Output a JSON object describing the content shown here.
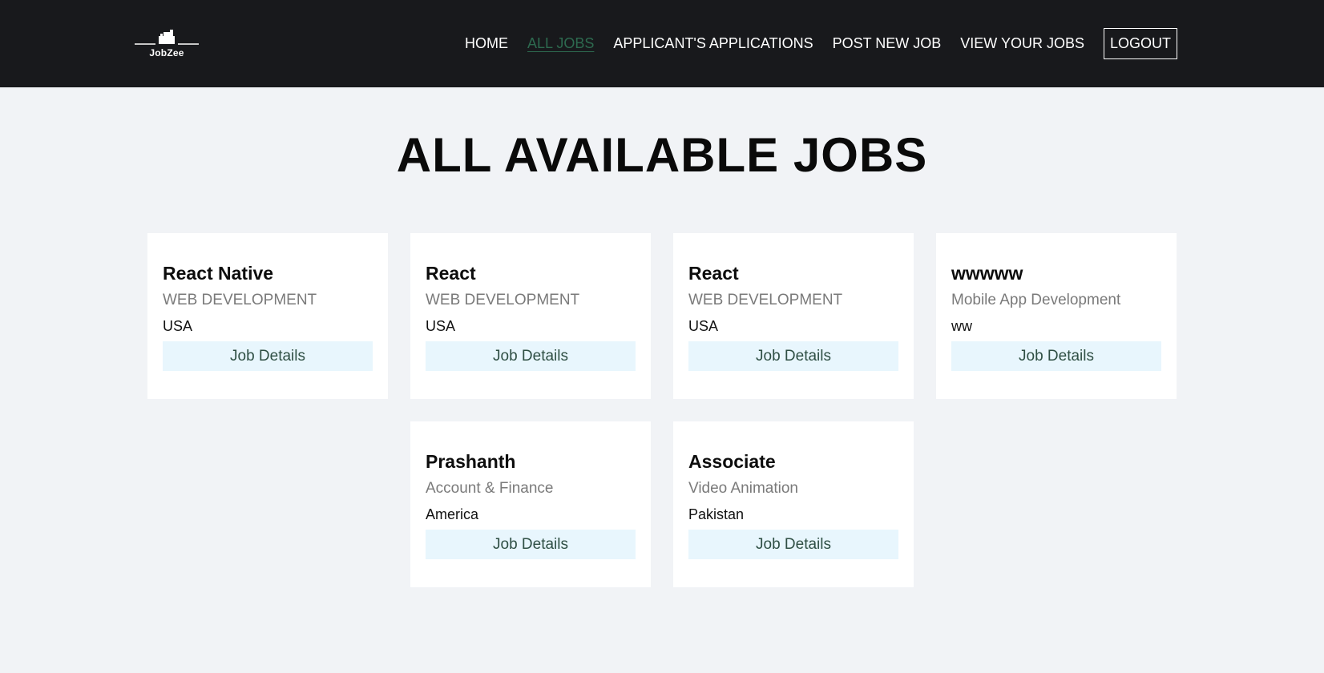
{
  "brand": {
    "name": "JobZee"
  },
  "nav": {
    "items": [
      {
        "label": "HOME",
        "active": false
      },
      {
        "label": "ALL JOBS",
        "active": true
      },
      {
        "label": "APPLICANT'S APPLICATIONS",
        "active": false
      },
      {
        "label": "POST NEW JOB",
        "active": false
      },
      {
        "label": "VIEW YOUR JOBS",
        "active": false
      }
    ],
    "logout_label": "LOGOUT"
  },
  "page": {
    "title": "ALL AVAILABLE JOBS"
  },
  "jobs": [
    {
      "title": "React Native",
      "category": "WEB DEVELOPMENT",
      "country": "USA",
      "button": "Job Details"
    },
    {
      "title": "React",
      "category": "WEB DEVELOPMENT",
      "country": "USA",
      "button": "Job Details"
    },
    {
      "title": "React",
      "category": "WEB DEVELOPMENT",
      "country": "USA",
      "button": "Job Details"
    },
    {
      "title": "wwwww",
      "category": "Mobile App Development",
      "country": "ww",
      "button": "Job Details"
    },
    {
      "title": "Prashanth",
      "category": "Account & Finance",
      "country": "America",
      "button": "Job Details"
    },
    {
      "title": "Associate",
      "category": "Video Animation",
      "country": "Pakistan",
      "button": "Job Details"
    }
  ],
  "colors": {
    "navbar_bg": "#18191c",
    "page_bg": "#f1f3f6",
    "active_link": "#2d6a4f",
    "button_bg": "#e8f6fd"
  },
  "icons": {
    "logo": "briefcase-skyline-icon"
  }
}
